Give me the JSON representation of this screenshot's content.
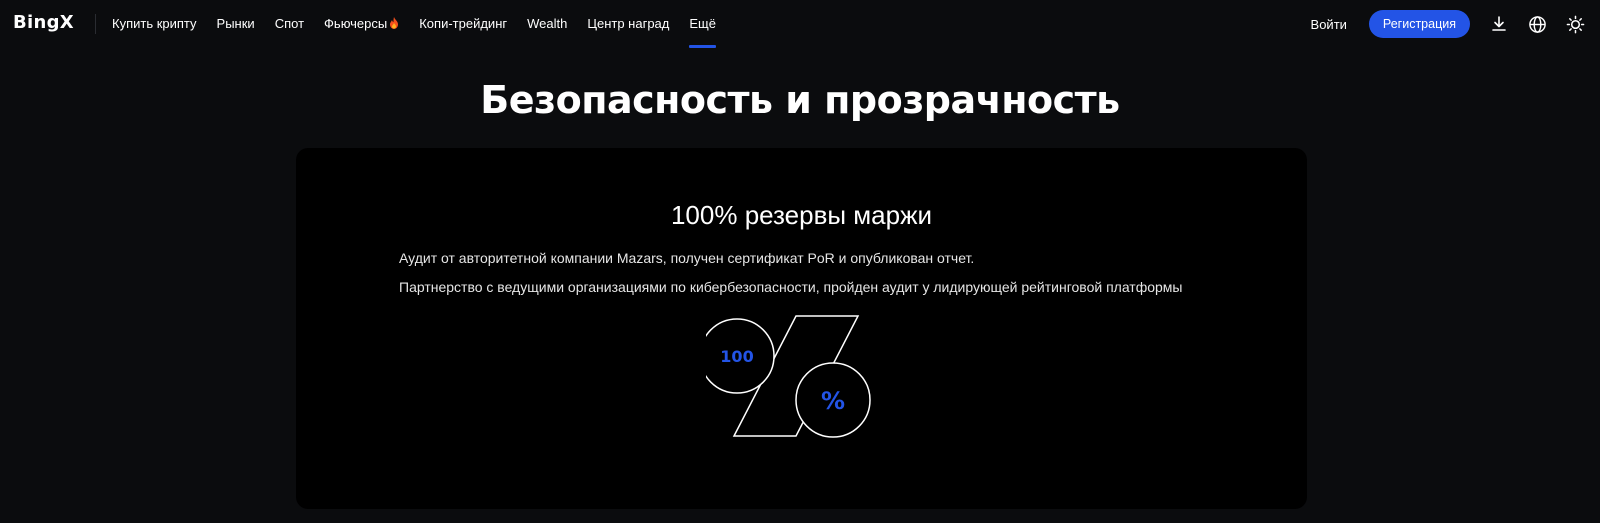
{
  "header": {
    "logo": "BingX",
    "nav": [
      {
        "label": "Купить крипту"
      },
      {
        "label": "Рынки"
      },
      {
        "label": "Спот"
      },
      {
        "label": "Фьючерсы"
      },
      {
        "label": "Копи-трейдинг"
      },
      {
        "label": "Wealth"
      },
      {
        "label": "Центр наград"
      },
      {
        "label": "Ещё"
      }
    ],
    "active_nav": "Ещё",
    "login_label": "Войти",
    "register_label": "Регистрация",
    "icons": [
      "download-icon",
      "globe-icon",
      "sun-icon"
    ]
  },
  "section": {
    "title": "Безопасность и прозрачность",
    "card": {
      "title": "100% резервы маржи",
      "lines": [
        "Аудит от авторитетной компании Mazars, получен сертификат PoR и опубликован отчет.",
        "Партнерство с ведущими организациями по кибербезопасности, пройден аудит у лидирующей рейтинговой платформы"
      ],
      "illustration": {
        "number": "100",
        "symbol": "%"
      }
    }
  },
  "colors": {
    "accent": "#2354e6",
    "background": "#0b0c0e",
    "card_background": "#000000"
  }
}
